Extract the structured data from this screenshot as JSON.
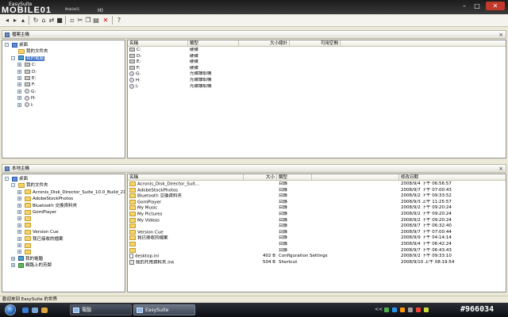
{
  "window": {
    "title": "EasySuite",
    "logo_text": "MOBILE01",
    "logo_sub": "Mobile01",
    "help_letter": "H)"
  },
  "icons": {
    "window_minimize": "minimize-icon",
    "window_maximize": "maximize-icon",
    "window_close": "close-icon",
    "delete": "delete-icon",
    "help": "help-icon"
  },
  "toolbar": {
    "delete_glyph": "✕",
    "help_glyph": "?"
  },
  "top_pane": {
    "header": "檔案主機",
    "tree": [
      {
        "label": "桌面",
        "icon": "desktop",
        "indent": 0,
        "expander": "-"
      },
      {
        "label": "我的文件夾",
        "icon": "folder",
        "indent": 1,
        "expander": ""
      },
      {
        "label": "我的電腦",
        "icon": "computer",
        "indent": 1,
        "expander": "-",
        "selected": true
      },
      {
        "label": "C:",
        "icon": "drive",
        "indent": 2,
        "expander": "+"
      },
      {
        "label": "D:",
        "icon": "drive",
        "indent": 2,
        "expander": "+"
      },
      {
        "label": "E:",
        "icon": "drive",
        "indent": 2,
        "expander": "+"
      },
      {
        "label": "F:",
        "icon": "drive",
        "indent": 2,
        "expander": "+"
      },
      {
        "label": "G:",
        "icon": "cd",
        "indent": 2,
        "expander": "+"
      },
      {
        "label": "H:",
        "icon": "cd",
        "indent": 2,
        "expander": "+"
      },
      {
        "label": "I:",
        "icon": "cd",
        "indent": 2,
        "expander": "+"
      }
    ],
    "columns": [
      "名稱",
      "類型",
      "大小總計",
      "可用空間"
    ],
    "rows": [
      {
        "name": "C:",
        "type": "硬碟",
        "icon": "drive"
      },
      {
        "name": "D:",
        "type": "硬碟",
        "icon": "drive"
      },
      {
        "name": "E:",
        "type": "硬碟",
        "icon": "drive"
      },
      {
        "name": "F:",
        "type": "硬碟",
        "icon": "drive"
      },
      {
        "name": "G:",
        "type": "光碟讀取機",
        "icon": "cd"
      },
      {
        "name": "H:",
        "type": "光碟讀取機",
        "icon": "cd"
      },
      {
        "name": "I:",
        "type": "光碟讀取機",
        "icon": "cd"
      }
    ]
  },
  "bottom_pane": {
    "header": "本地主機",
    "tree": [
      {
        "label": "桌面",
        "icon": "desktop",
        "indent": 0,
        "expander": "-"
      },
      {
        "label": "我的文件夾",
        "icon": "folder",
        "indent": 1,
        "expander": "-"
      },
      {
        "label": "Acronis_Disk_Director_Suite_10.0_Build_211",
        "icon": "folder",
        "indent": 2,
        "expander": "+"
      },
      {
        "label": "AdobeStockPhotos",
        "icon": "folder",
        "indent": 2,
        "expander": "+"
      },
      {
        "label": "Bluetooth 交換資料夾",
        "icon": "folder",
        "indent": 2,
        "expander": "+"
      },
      {
        "label": "GomPlayer",
        "icon": "folder",
        "indent": 2,
        "expander": "+"
      },
      {
        "label": "",
        "icon": "folder",
        "indent": 2,
        "expander": "+"
      },
      {
        "label": "",
        "icon": "folder",
        "indent": 2,
        "expander": "+"
      },
      {
        "label": "Version Cue",
        "icon": "folder",
        "indent": 2,
        "expander": "+"
      },
      {
        "label": "我已接收的檔案",
        "icon": "folder",
        "indent": 2,
        "expander": "+"
      },
      {
        "label": "",
        "icon": "folder",
        "indent": 2,
        "expander": "+"
      },
      {
        "label": "",
        "icon": "folder",
        "indent": 2,
        "expander": "+"
      },
      {
        "label": "我的電腦",
        "icon": "computer",
        "indent": 1,
        "expander": "+"
      },
      {
        "label": "網路上的芳鄰",
        "icon": "network",
        "indent": 1,
        "expander": "+"
      }
    ],
    "columns": [
      "名稱",
      "大小",
      "類型",
      "修改日期"
    ],
    "rows": [
      {
        "name": "Acronis_Disk_Director_Suit...",
        "size": "",
        "type": "目錄",
        "date": "2008/9/4 下午 06:56:57",
        "icon": "folder"
      },
      {
        "name": "AdobeStockPhotos",
        "size": "",
        "type": "目錄",
        "date": "2008/9/7 下午 07:00:43",
        "icon": "folder"
      },
      {
        "name": "Bluetooth 交換資料夾",
        "size": "",
        "type": "目錄",
        "date": "2008/9/2 下午 09:33:52",
        "icon": "folder"
      },
      {
        "name": "GomPlayer",
        "size": "",
        "type": "目錄",
        "date": "2008/9/3 上午 11:25:57",
        "icon": "folder"
      },
      {
        "name": "My Music",
        "size": "",
        "type": "目錄",
        "date": "2008/9/2 下午 09:20:24",
        "icon": "folder"
      },
      {
        "name": "My Pictures",
        "size": "",
        "type": "目錄",
        "date": "2008/9/2 下午 09:20:24",
        "icon": "folder"
      },
      {
        "name": "My Videos",
        "size": "",
        "type": "目錄",
        "date": "2008/9/2 下午 09:20:24",
        "icon": "folder"
      },
      {
        "name": "",
        "size": "",
        "type": "目錄",
        "date": "2008/9/7 下午 06:32:40",
        "icon": "folder"
      },
      {
        "name": "Version Cue",
        "size": "",
        "type": "目錄",
        "date": "2008/9/7 下午 07:00:44",
        "icon": "folder"
      },
      {
        "name": "我已接收的檔案",
        "size": "",
        "type": "目錄",
        "date": "2008/9/9 下午 04:14:14",
        "icon": "folder"
      },
      {
        "name": "",
        "size": "",
        "type": "目錄",
        "date": "2008/9/4 下午 06:42:24",
        "icon": "folder"
      },
      {
        "name": "",
        "size": "",
        "type": "目錄",
        "date": "2008/9/7 下午 06:43:43",
        "icon": "folder"
      },
      {
        "name": "desktop.ini",
        "size": "402 B",
        "type": "Configuration Settings",
        "date": "2008/9/2 下午 09:33:10",
        "icon": "file"
      },
      {
        "name": "我的共用資料夾.lnk",
        "size": "504 B",
        "type": "Shortcut",
        "date": "2008/9/10 上午 08:19:54",
        "icon": "link"
      }
    ]
  },
  "status": {
    "text": "歡迎來到 EasySuite 的世界"
  },
  "taskbar": {
    "tasks": [
      "電腦",
      "EasySuite"
    ],
    "tray_text": "<<",
    "watermark": "#966034"
  },
  "colors": {
    "selection": "#316ac5",
    "titlebar": "#1b1b1b",
    "close_button": "#c0392b"
  }
}
